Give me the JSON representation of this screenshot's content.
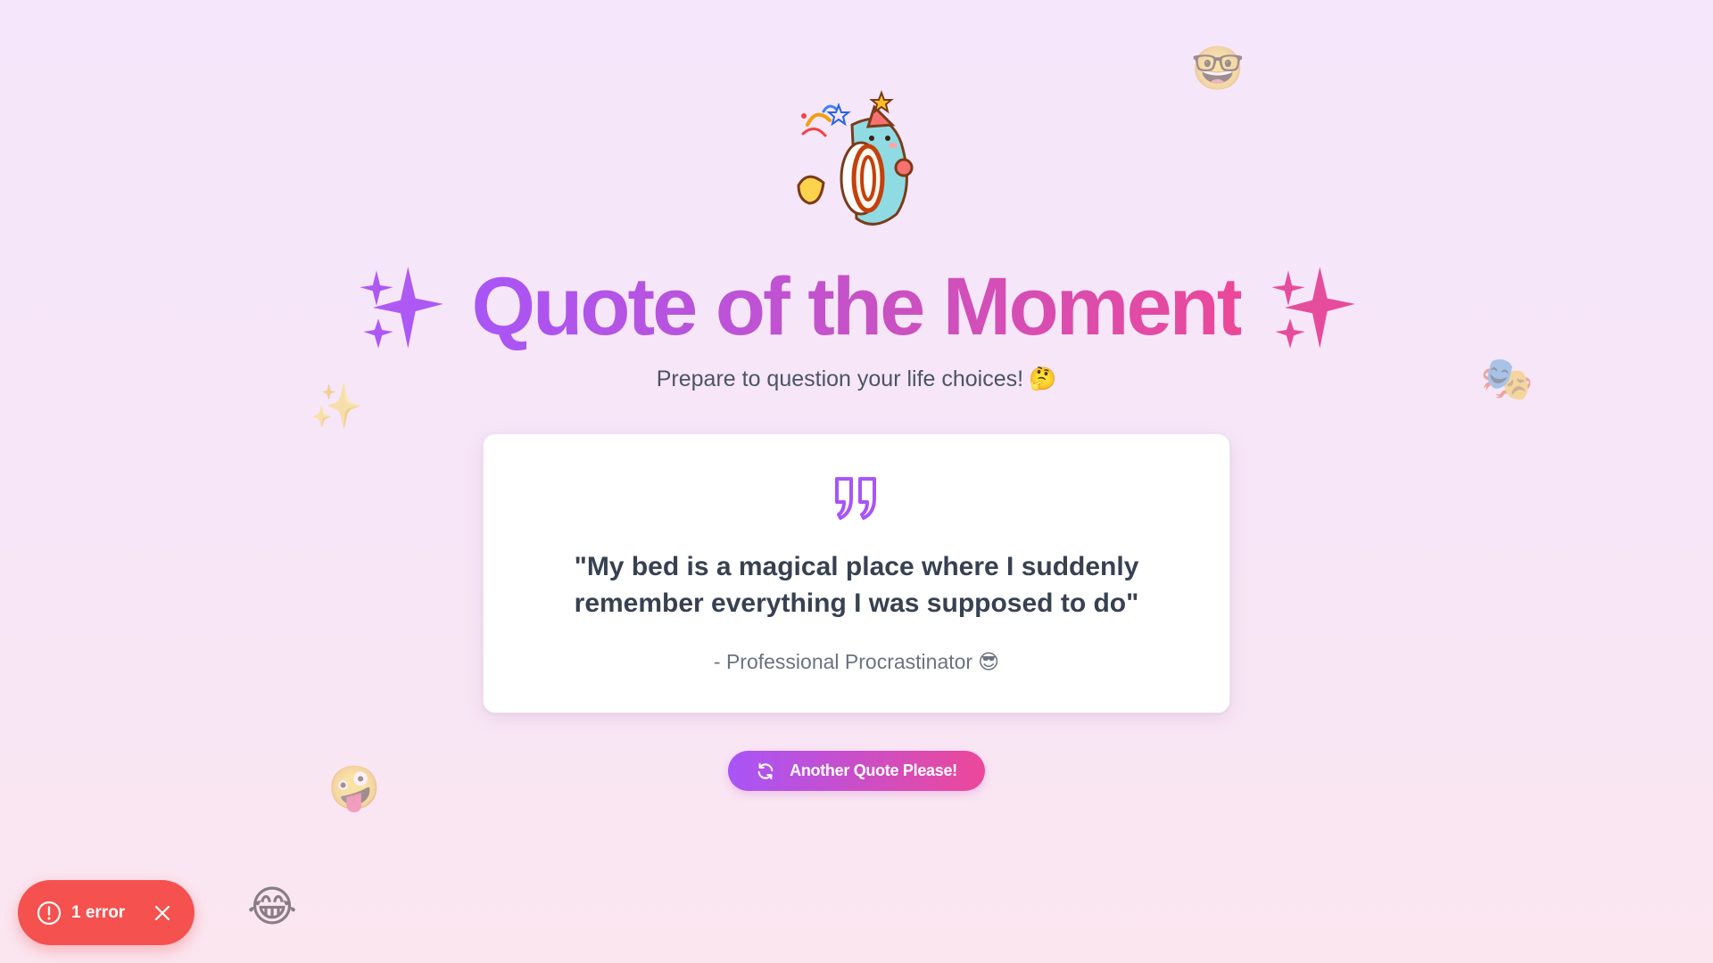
{
  "header": {
    "title": "Quote of the Moment",
    "subtitle": "Prepare to question your life choices!",
    "subtitle_emoji": "🤔",
    "left_icon": "sparkle-icon",
    "right_icon": "sparkle-icon",
    "mascot_icon": "party-drum-mascot-icon"
  },
  "quote": {
    "icon": "quote-mark-icon",
    "text": "\"My bed is a magical place where I suddenly remember everything I was supposed to do\"",
    "author": "- Professional Procrastinator",
    "author_emoji": "😎"
  },
  "button": {
    "label": "Another Quote Please!",
    "icon": "refresh-icon"
  },
  "error_toast": {
    "label": "1 error",
    "icon": "alert-circle-icon",
    "close_icon": "close-icon"
  },
  "floating_emojis": [
    {
      "name": "nerd-face-emoji",
      "char": "🤓"
    },
    {
      "name": "sparkles-emoji",
      "char": "✨"
    },
    {
      "name": "theater-masks-emoji",
      "char": "🎭"
    },
    {
      "name": "zany-face-emoji",
      "char": "🤪"
    },
    {
      "name": "joy-face-emoji",
      "char": "😂"
    }
  ],
  "colors": {
    "accent_purple": "#a855f7",
    "accent_pink": "#ec4899",
    "error_red": "#f4514f",
    "text_dark": "#374151",
    "text_muted": "#6b7280"
  }
}
